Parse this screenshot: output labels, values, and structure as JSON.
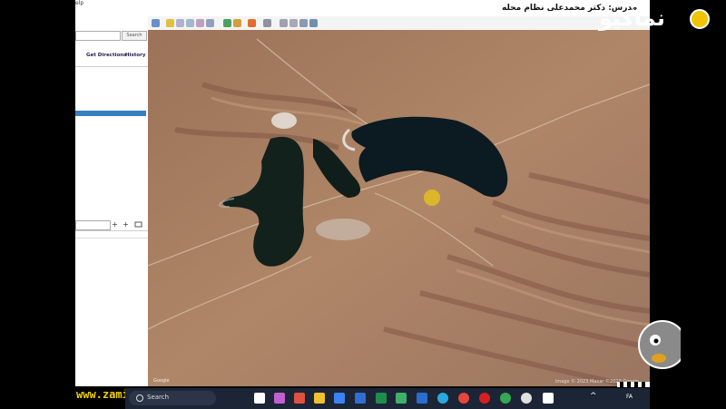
{
  "app": {
    "menu_help_fragment": "elp",
    "instructor_label": "مدرس: دکتر محمدعلی نظام محله"
  },
  "sidebar": {
    "search_button": "Search",
    "get_directions": "Get Directions",
    "history": "History",
    "plus": "+",
    "minus": "+"
  },
  "map": {
    "attribution": "Image © 2023 Maxar   ©2023 Google",
    "scale": "Google"
  },
  "branding": {
    "logo_text": "نماکیو",
    "watermark": "www.zaminx.ir"
  },
  "taskbar": {
    "search_label": "Search",
    "language": "FA",
    "tray_arrow": "^"
  },
  "colors": {
    "lake": "#0c1a22",
    "terrain": "#a07a5e",
    "selection": "#3a7fc0",
    "taskbar": "#1c2536",
    "watermark": "#f1d000"
  }
}
